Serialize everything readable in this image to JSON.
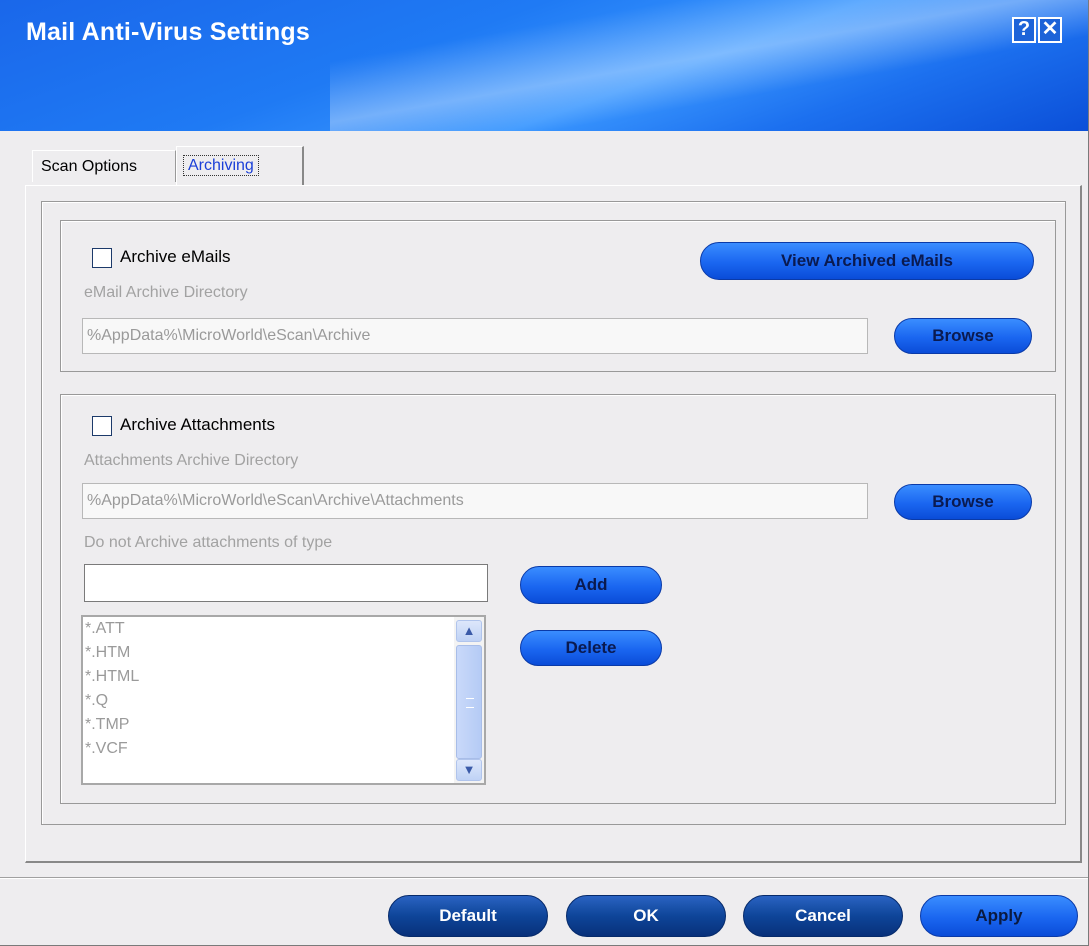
{
  "window": {
    "title": "Mail Anti-Virus Settings"
  },
  "title_buttons": {
    "help": "?",
    "close": "✕"
  },
  "tabs": [
    {
      "label": "Scan Options",
      "active": false
    },
    {
      "label": "Archiving",
      "active": true
    }
  ],
  "emails": {
    "checkbox_label": "Archive eMails",
    "checked": false,
    "view_button": "View Archived eMails",
    "dir_label": "eMail Archive Directory",
    "dir_value": "%AppData%\\MicroWorld\\eScan\\Archive",
    "browse_button": "Browse"
  },
  "attachments": {
    "checkbox_label": "Archive Attachments",
    "checked": false,
    "dir_label": "Attachments Archive Directory",
    "dir_value": "%AppData%\\MicroWorld\\eScan\\Archive\\Attachments",
    "browse_button": "Browse",
    "exclude_label": "Do not Archive attachments of type",
    "exclude_input_value": "",
    "add_button": "Add",
    "delete_button": "Delete",
    "types": [
      "*.ATT",
      "*.HTM",
      "*.HTML",
      "*.Q",
      "*.TMP",
      "*.VCF"
    ]
  },
  "footer": {
    "default_button": "Default",
    "ok_button": "OK",
    "cancel_button": "Cancel",
    "apply_button": "Apply"
  },
  "icons": {
    "scroll_up": "chevron-up-icon",
    "scroll_down": "chevron-down-icon"
  }
}
